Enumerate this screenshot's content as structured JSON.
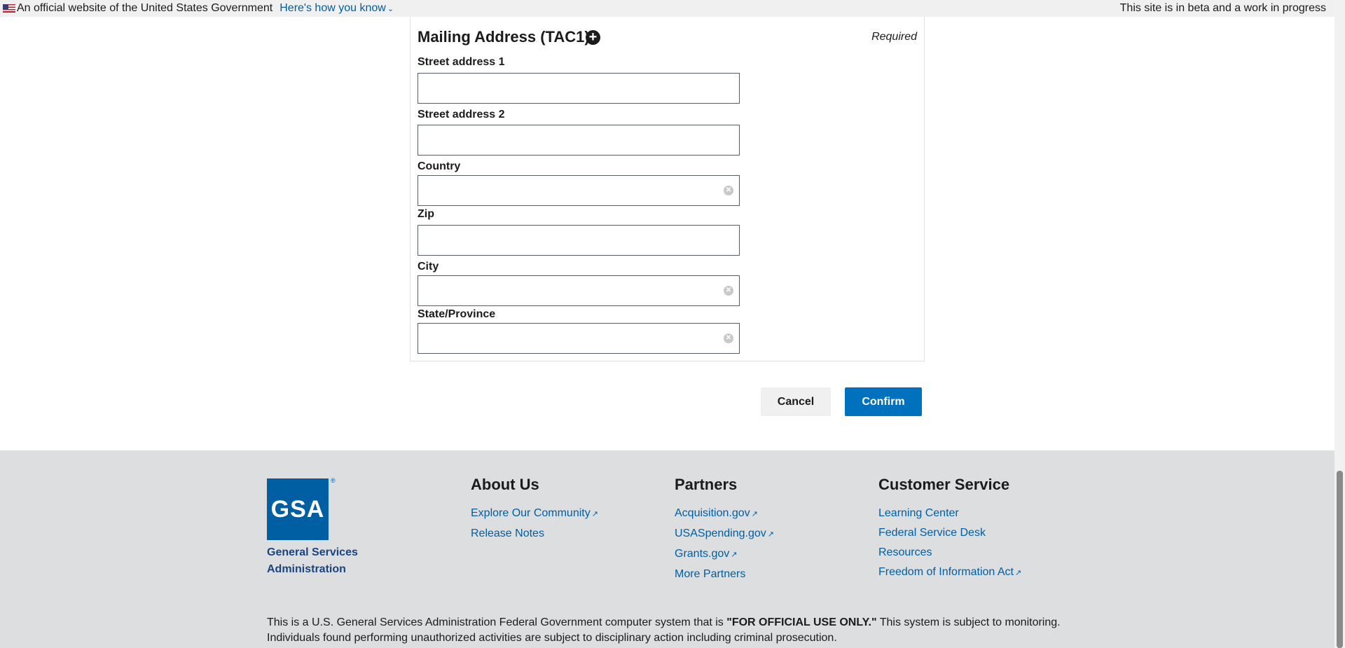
{
  "banner": {
    "official_text": "An official website of the United States Government",
    "how_link": "Here's how you know",
    "beta_text": "This site is in beta and a work in progress"
  },
  "form": {
    "section_title": "Mailing Address (TAC1)",
    "required_text": "Required",
    "fields": {
      "street1": {
        "label": "Street address 1",
        "value": ""
      },
      "street2": {
        "label": "Street address 2",
        "value": ""
      },
      "country": {
        "label": "Country",
        "value": ""
      },
      "zip": {
        "label": "Zip",
        "value": ""
      },
      "city": {
        "label": "City",
        "value": ""
      },
      "state": {
        "label": "State/Province",
        "value": ""
      }
    },
    "cancel_label": "Cancel",
    "confirm_label": "Confirm"
  },
  "footer": {
    "logo_text": "GSA",
    "org_name": "General Services Administration",
    "about": {
      "heading": "About Us",
      "links": [
        "Explore Our Community",
        "Release Notes"
      ]
    },
    "partners": {
      "heading": "Partners",
      "links": [
        "Acquisition.gov",
        "USASpending.gov",
        "Grants.gov",
        "More Partners"
      ]
    },
    "customer_service": {
      "heading": "Customer Service",
      "links": [
        "Learning Center",
        "Federal Service Desk",
        "Resources",
        "Freedom of Information Act"
      ]
    },
    "disclaimer_pre": "This is a U.S. General Services Administration Federal Government computer system that is ",
    "disclaimer_bold": "\"FOR OFFICIAL USE ONLY.\"",
    "disclaimer_post": " This system is subject to monitoring. Individuals found performing unauthorized activities are subject to disciplinary action including criminal prosecution."
  },
  "colors": {
    "link": "#005ea2",
    "primary_button": "#0071bc",
    "footer_bg": "#dcdee0",
    "gsa_blue": "#005ea2"
  }
}
